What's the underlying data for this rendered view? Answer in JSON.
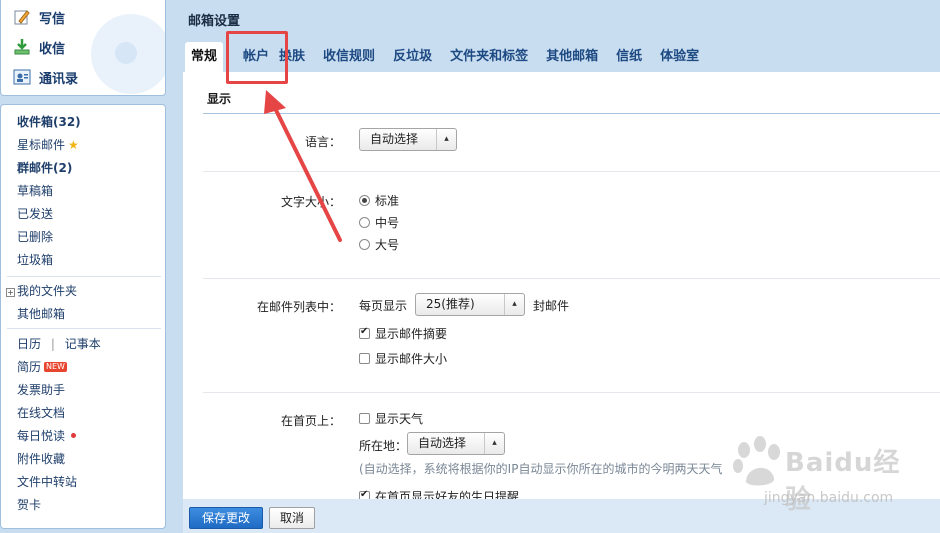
{
  "sidebar": {
    "compose": [
      {
        "label": "写信",
        "icon": "pencil-icon"
      },
      {
        "label": "收信",
        "icon": "inbox-download-icon"
      },
      {
        "label": "通讯录",
        "icon": "contacts-icon"
      }
    ],
    "folders": [
      {
        "label": "收件箱(32)",
        "bold": true
      },
      {
        "label": "星标邮件",
        "icon": "star-icon"
      },
      {
        "label": "群邮件(2)",
        "bold": true
      },
      {
        "label": "草稿箱"
      },
      {
        "label": "已发送"
      },
      {
        "label": "已删除"
      },
      {
        "label": "垃圾箱"
      }
    ],
    "my_folders": "我的文件夹",
    "other_mailbox": "其他邮箱",
    "calendar": "日历",
    "separator": "|",
    "notebook": "记事本",
    "resume": "简历",
    "new_badge": "NEW",
    "invoice": "发票助手",
    "docs": "在线文档",
    "daily": "每日悦读",
    "attachments": "附件收藏",
    "file_transfer": "文件中转站",
    "greeting_card": "贺卡"
  },
  "main": {
    "title": "邮箱设置",
    "tabs": [
      "常规",
      "帐户",
      "换肤",
      "收信规则",
      "反垃圾",
      "文件夹和标签",
      "其他邮箱",
      "信纸",
      "体验室"
    ],
    "active_tab": "常规",
    "section_title": "显示",
    "language": {
      "label": "语言：",
      "value": "自动选择"
    },
    "font_size": {
      "label": "文字大小：",
      "options": [
        "标准",
        "中号",
        "大号"
      ],
      "selected": "标准"
    },
    "mail_list": {
      "label": "在邮件列表中：",
      "per_page_prefix": "每页显示",
      "per_page_value": "25(推荐)",
      "per_page_suffix": "封邮件",
      "show_summary": "显示邮件摘要",
      "show_summary_checked": true,
      "show_size": "显示邮件大小",
      "show_size_checked": false
    },
    "home": {
      "label": "在首页上：",
      "show_weather": "显示天气",
      "show_weather_checked": false,
      "location_label": "所在地：",
      "location_value": "自动选择",
      "hint": "(自动选择，系统将根据你的IP自动显示你所在的城市的今明两天天气",
      "birthday": "在首页显示好友的生日提醒",
      "birthday_checked": true
    }
  },
  "footer": {
    "save": "保存更改",
    "cancel": "取消"
  },
  "watermark": {
    "text": "Baidu经验",
    "url": "jingyan.baidu.com"
  },
  "colors": {
    "accent": "#1f6bc4",
    "annotation": "#e64545"
  }
}
